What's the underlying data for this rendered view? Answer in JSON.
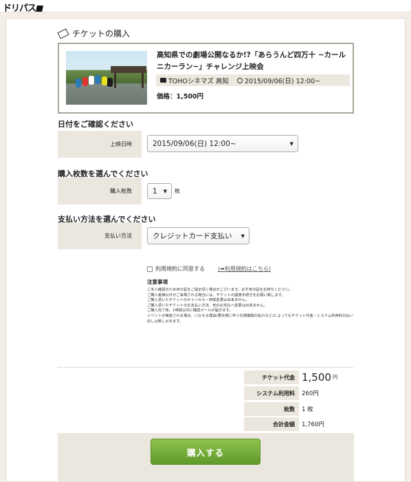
{
  "site": {
    "logo": "ドリパス"
  },
  "ticket": {
    "heading": "チケットの購入",
    "event_title": "高知県での劇場公開なるか!?「あらうんど四万十 ~カールニカーラン~」チャレンジ上映会",
    "theater": "TOHOシネマズ 高知",
    "datetime": "2015/09/06(日) 12:00~",
    "price_text": "価格：1,500円"
  },
  "date_section": {
    "title": "日付をご確認ください",
    "label": "上映日時",
    "selected": "2015/09/06(日) 12:00~"
  },
  "quantity_section": {
    "title": "購入枚数を選んでください",
    "label": "購入枚数",
    "selected": "1",
    "unit": "枚"
  },
  "payment_section": {
    "title": "支払い方法を選んでください",
    "label": "支払い方法",
    "selected": "クレジットカード支払い"
  },
  "agreement": {
    "checkbox_label": "利用規約に同意する",
    "link_text": "(➡利用規約はこちら)"
  },
  "notes": {
    "title": "注意事項",
    "lines": [
      "ご本人確認のため身分証をご提示頂く場合がございます。必ず身分証をお持ちください。",
      "ご購入者様以外がご来場される場合には、チケットの譲渡手続きをお願い致します。",
      "ご購入頂いたチケットのキャンセル・時間変更は出来ません。",
      "ご購入頂いたチケットのお支払い方法、他のお支払へ変更は出来ません。",
      "ご購入完了後、1時間以内に確認メールが届きます。",
      "イベントが実施される場合、いかなる理由(悪天候に伴う交通機関の乱れなど)によってもチケット代金・システム利用料の払い戻しは致しかねます。"
    ]
  },
  "summary": {
    "ticket_price_label": "チケット代金",
    "ticket_price": "1,500",
    "ticket_price_unit": "円",
    "system_fee_label": "システム利用料",
    "system_fee": "260円",
    "count_label": "枚数",
    "count": "1 枚",
    "total_label": "合計金額",
    "total": "1,760円"
  },
  "buy_button": "購入する",
  "colors": {
    "button_green": "#6aa832",
    "label_bg": "#ece7de",
    "page_bg": "#f3efe8"
  }
}
